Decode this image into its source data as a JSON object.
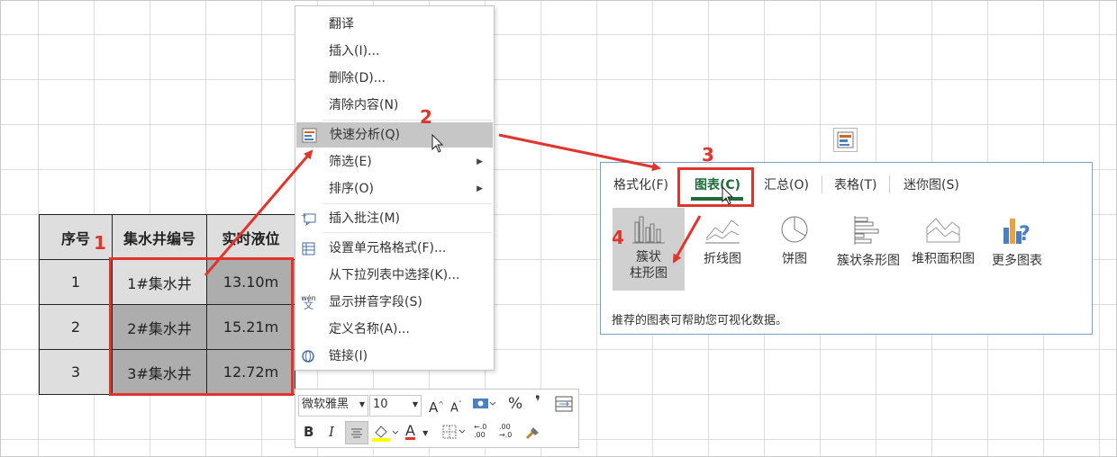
{
  "table": {
    "headers": [
      "序号",
      "集水井编号",
      "实时液位"
    ],
    "rows": [
      [
        "1",
        "1#集水井",
        "13.10m"
      ],
      [
        "2",
        "2#集水井",
        "15.21m"
      ],
      [
        "3",
        "3#集水井",
        "12.72m"
      ]
    ]
  },
  "annotations": {
    "n1": "1",
    "n2": "2",
    "n3": "3",
    "n4": "4",
    "color": "#e0342c"
  },
  "context_menu": {
    "items": [
      {
        "label": "翻译",
        "icon": ""
      },
      {
        "label": "插入(I)...",
        "icon": ""
      },
      {
        "label": "删除(D)...",
        "icon": ""
      },
      {
        "label": "清除内容(N)",
        "icon": ""
      },
      {
        "label": "快速分析(Q)",
        "icon": "quick-analysis-icon"
      },
      {
        "label": "筛选(E)",
        "icon": ""
      },
      {
        "label": "排序(O)",
        "icon": ""
      },
      {
        "label": "插入批注(M)",
        "icon": "comment-icon"
      },
      {
        "label": "设置单元格格式(F)...",
        "icon": "format-cells-icon"
      },
      {
        "label": "从下拉列表中选择(K)...",
        "icon": ""
      },
      {
        "label": "显示拼音字段(S)",
        "icon": "phonetic-icon"
      },
      {
        "label": "定义名称(A)...",
        "icon": ""
      },
      {
        "label": "链接(I)",
        "icon": "link-icon"
      }
    ]
  },
  "mini_toolbar": {
    "font_name": "微软雅黑",
    "font_size": "10",
    "grow_font": "A",
    "shrink_font": "A",
    "percent": "%",
    "comma": "❜",
    "bold": "B",
    "italic": "I",
    "font_color_glyph": "A",
    "inc_decimal": "←.0\n.00",
    "dec_decimal": ".00\n→.0"
  },
  "quick_analysis": {
    "tabs": [
      "格式化(F)",
      "图表(C)",
      "汇总(O)",
      "表格(T)",
      "迷你图(S)"
    ],
    "active_tab": "图表(C)",
    "charts": [
      {
        "label": "簇状\n柱形图",
        "icon": "clustered-column-icon"
      },
      {
        "label": "折线图",
        "icon": "line-chart-icon"
      },
      {
        "label": "饼图",
        "icon": "pie-chart-icon"
      },
      {
        "label": "簇状条形图",
        "icon": "clustered-bar-icon"
      },
      {
        "label": "堆积面积图",
        "icon": "stacked-area-icon"
      },
      {
        "label": "更多图表",
        "icon": "more-charts-icon"
      }
    ],
    "footer": "推荐的图表可帮助您可视化数据。"
  }
}
